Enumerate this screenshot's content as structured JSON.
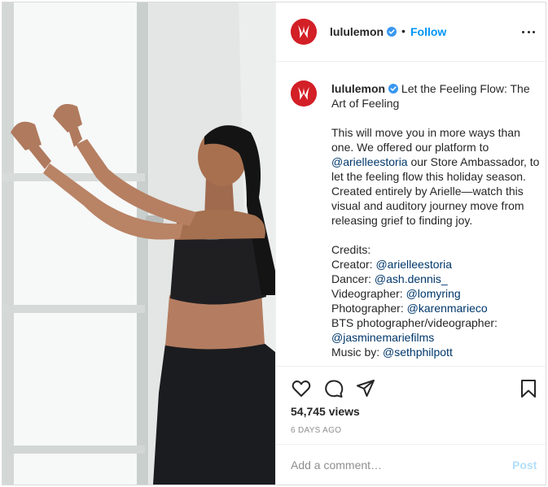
{
  "brand": {
    "accent": "#d31f26",
    "link": "#00376b",
    "follow_color": "#0095f6"
  },
  "header": {
    "username": "lululemon",
    "separator": "•",
    "follow_label": "Follow",
    "avatar_icon": "lululemon-logo-icon",
    "verified_icon": "verified-badge-icon",
    "more_icon": "more-options-icon"
  },
  "caption": {
    "username": "lululemon",
    "title_text": " Let the Feeling Flow: The Art of Feeling",
    "body": {
      "part1": "This will move you in more ways than one. We offered our platform to ",
      "mention1": "@arielleestoria",
      "part2": " our Store Ambassador, to let the feeling flow this holiday season. Created entirely by Arielle—watch this visual and auditory journey move from releasing grief to finding joy."
    },
    "credits_title": "Credits:",
    "credits": [
      {
        "role": "Creator: ",
        "handle": "@arielleestoria"
      },
      {
        "role": "Dancer: ",
        "handle": "@ash.dennis_"
      },
      {
        "role": "Videographer: ",
        "handle": "@lomyring"
      },
      {
        "role": "Photographer: ",
        "handle": "@karenmarieco"
      },
      {
        "role": "BTS photographer/videographer: ",
        "handle": "@jasminemariefilms"
      },
      {
        "role": "Music by: ",
        "handle": "@sethphilpott"
      }
    ]
  },
  "actions": {
    "like_icon": "heart-icon",
    "comment_icon": "comment-icon",
    "share_icon": "share-icon",
    "save_icon": "bookmark-icon",
    "views": "54,745 views",
    "timestamp": "6 DAYS AGO"
  },
  "comment": {
    "placeholder": "Add a comment…",
    "post_label": "Post"
  },
  "media": {
    "description_icon": "video-frame"
  }
}
